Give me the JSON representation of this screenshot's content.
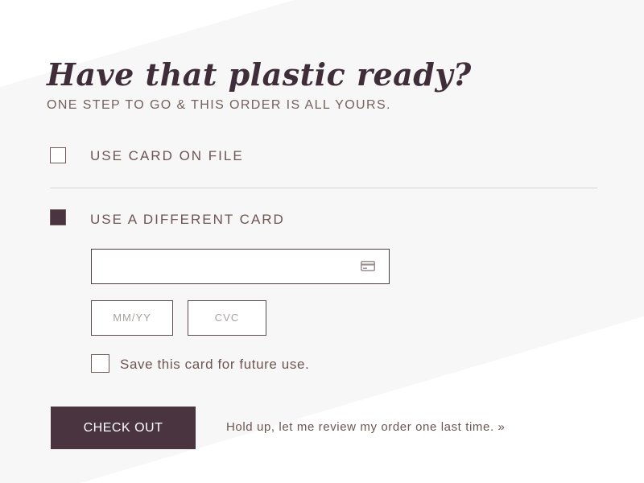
{
  "header": {
    "title": "Have that plastic ready?",
    "subtitle": "ONE STEP TO GO & THIS ORDER IS ALL YOURS."
  },
  "payment_options": [
    {
      "label": "USE CARD ON FILE",
      "checked": false
    },
    {
      "label": "USE A DIFFERENT CARD",
      "checked": true
    }
  ],
  "card_form": {
    "card_number": {
      "value": "",
      "icon": "credit-card-icon"
    },
    "expiry": {
      "placeholder": "MM/YY"
    },
    "cvc": {
      "placeholder": "CVC"
    },
    "save_card": {
      "label": "Save this card for future use.",
      "checked": false
    }
  },
  "actions": {
    "checkout_label": "CHECK OUT",
    "review_link": "Hold up, let me review my order one last time. »"
  },
  "colors": {
    "accent": "#4a3440",
    "heading": "#3f2e3a",
    "text": "#6e5552",
    "panel": "#f7f7f7"
  }
}
